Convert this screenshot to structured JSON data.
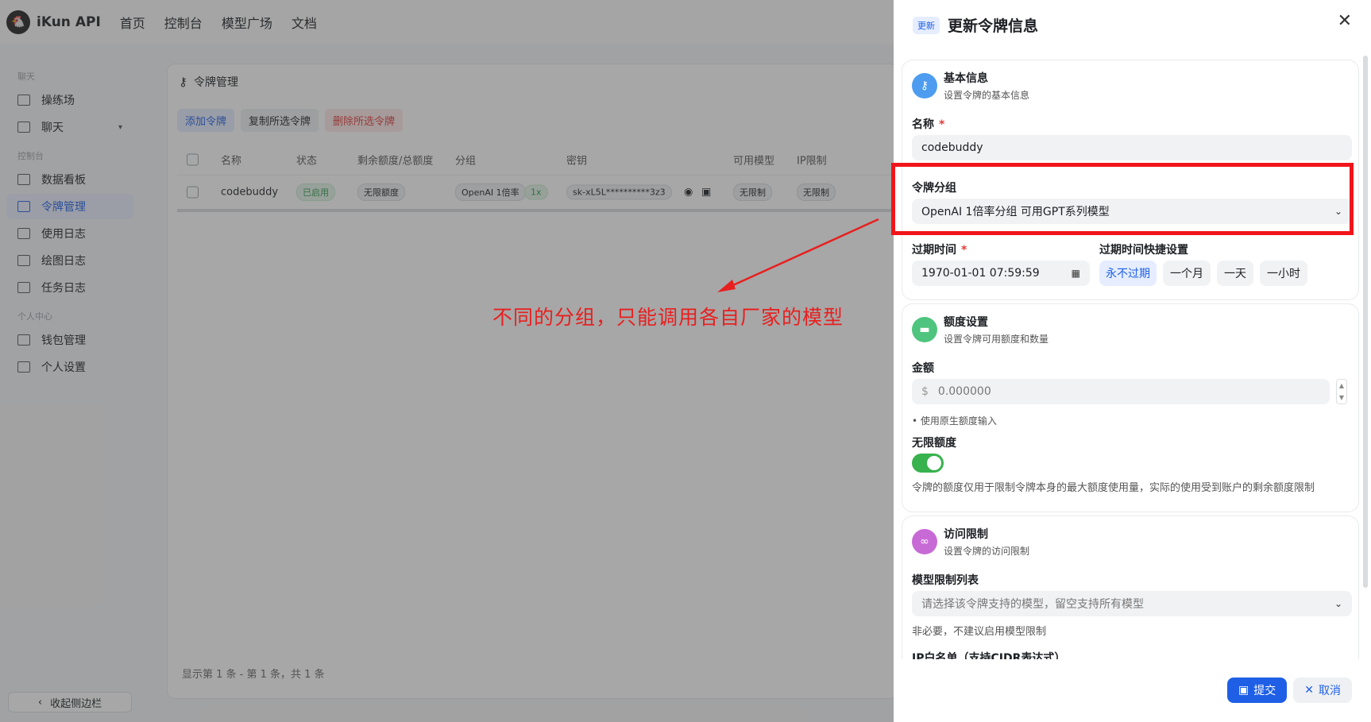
{
  "topbar": {
    "brand": "iKun API",
    "nav": [
      "首页",
      "控制台",
      "模型广场",
      "文档"
    ]
  },
  "sidebar": {
    "group_chat": "聊天",
    "item_playground": "操练场",
    "item_chat": "聊天",
    "group_console": "控制台",
    "item_dashboard": "数据看板",
    "item_tokens": "令牌管理",
    "item_usage": "使用日志",
    "item_drawing": "绘图日志",
    "item_tasks": "任务日志",
    "group_personal": "个人中心",
    "item_wallet": "钱包管理",
    "item_settings": "个人设置",
    "collapse": "收起侧边栏"
  },
  "panel": {
    "title": "令牌管理",
    "actions": {
      "add": "添加令牌",
      "copy": "复制所选令牌",
      "delete": "删除所选令牌"
    },
    "columns": {
      "name": "名称",
      "status": "状态",
      "quota": "剩余额度/总额度",
      "group": "分组",
      "key": "密钥",
      "models": "可用模型",
      "ip": "IP限制"
    },
    "row": {
      "name": "codebuddy",
      "status": "已启用",
      "quota": "无限额度",
      "group": "OpenAI 1倍率",
      "ratio": "1x",
      "key": "sk-xL5L**********3z3",
      "models": "无限制",
      "ip": "无限制"
    },
    "pager": "显示第 1 条 - 第 1 条，共 1 条"
  },
  "annotation": "不同的分组，只能调用各自厂家的模型",
  "drawer": {
    "badge": "更新",
    "title": "更新令牌信息",
    "basic": {
      "title": "基本信息",
      "subtitle": "设置令牌的基本信息",
      "name_label": "名称",
      "name_value": "codebuddy",
      "group_label": "令牌分组",
      "group_value": "OpenAI 1倍率分组 可用GPT系列模型",
      "expire_label": "过期时间",
      "expire_value": "1970-01-01 07:59:59",
      "quick_label": "过期时间快捷设置",
      "quick_options": [
        "永不过期",
        "一个月",
        "一天",
        "一小时"
      ]
    },
    "quota": {
      "title": "额度设置",
      "subtitle": "设置令牌可用额度和数量",
      "amount_label": "金额",
      "amount_prefix": "$",
      "amount_placeholder": "0.000000",
      "amount_hint": "• 使用原生额度输入",
      "unlimited_label": "无限额度",
      "unlimited_on": true,
      "unlimited_note": "令牌的额度仅用于限制令牌本身的最大额度使用量，实际的使用受到账户的剩余额度限制"
    },
    "access": {
      "title": "访问限制",
      "subtitle": "设置令牌的访问限制",
      "model_label": "模型限制列表",
      "model_placeholder": "请选择该令牌支持的模型，留空支持所有模型",
      "model_hint": "非必要，不建议启用模型限制",
      "ip_label": "IP白名单（支持CIDR表达式）"
    },
    "submit": "提交",
    "cancel": "取消"
  },
  "colors": {
    "accent": "#1f5fe6",
    "danger": "#e23b3b",
    "success": "#37b24d",
    "annotation": "#f0151b"
  }
}
